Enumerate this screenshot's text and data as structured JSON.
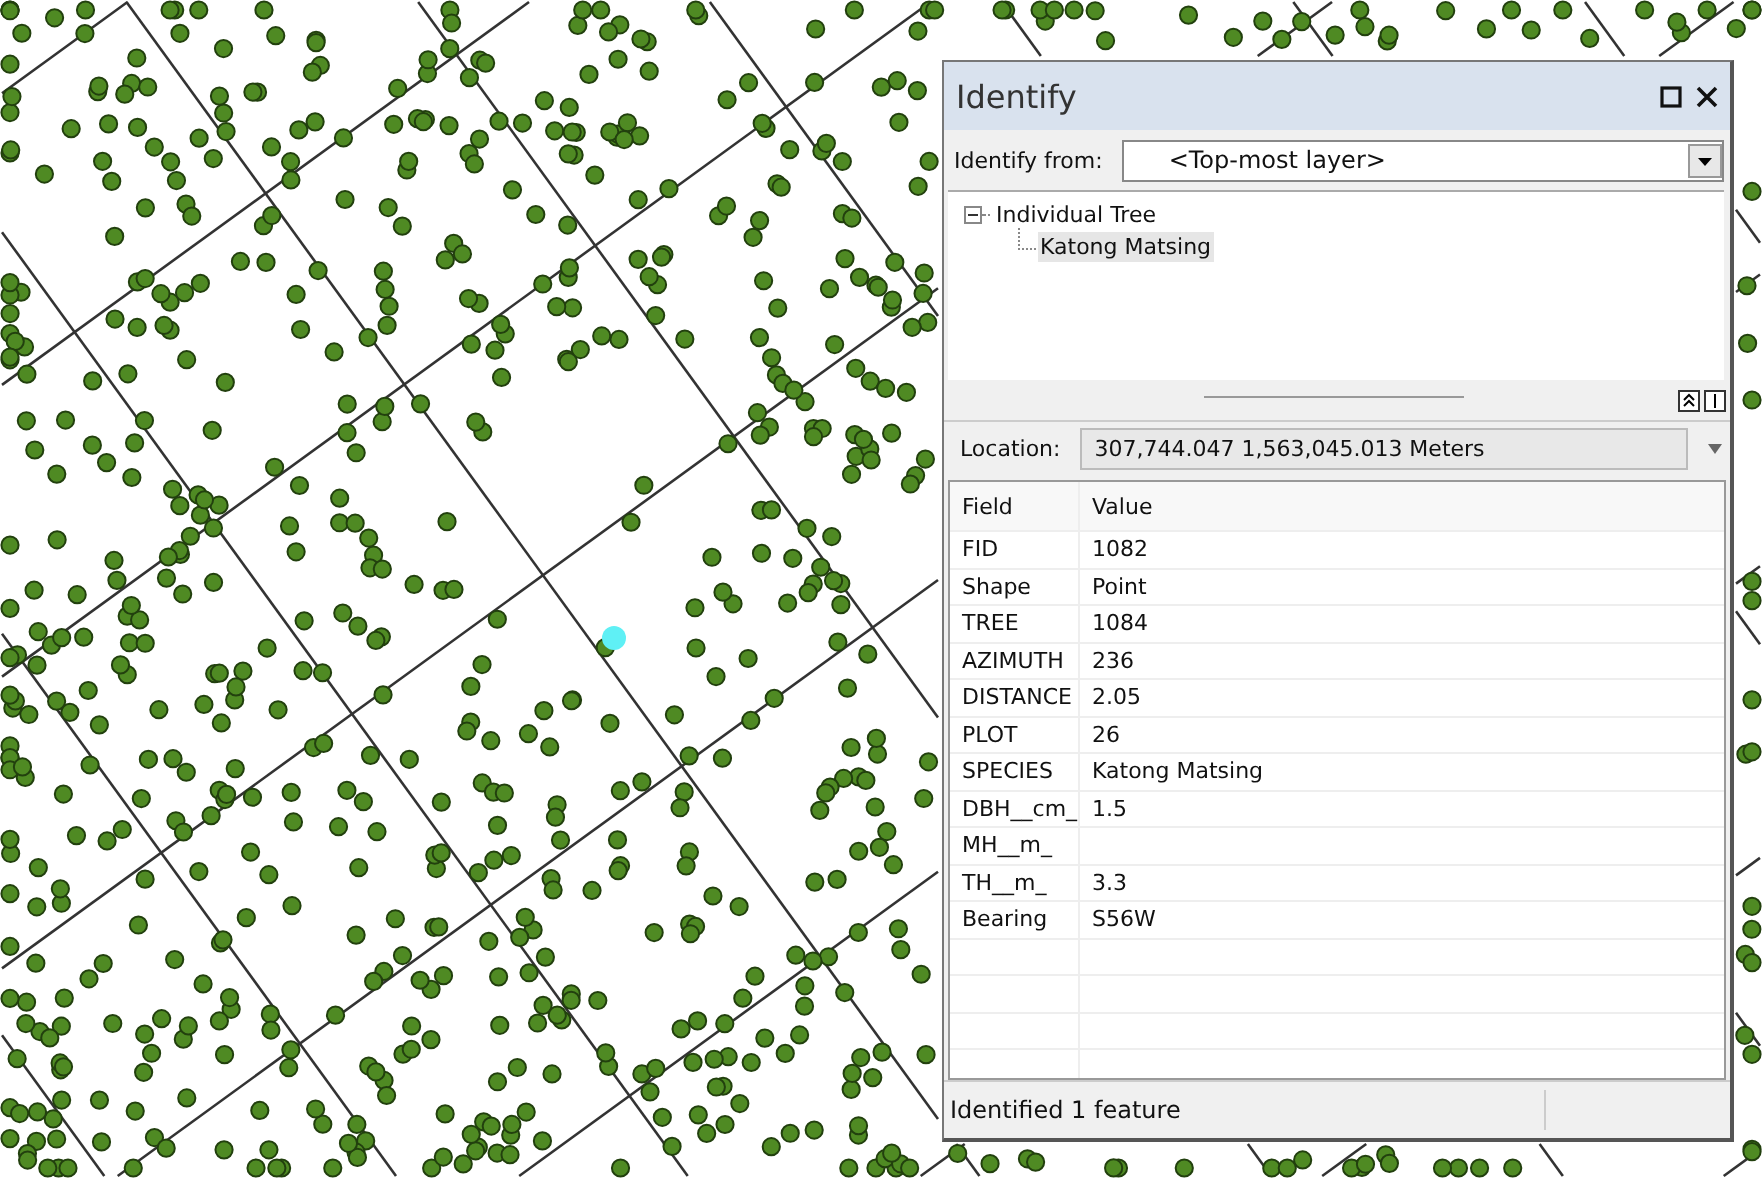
{
  "window": {
    "title": "Identify"
  },
  "identify_from": {
    "label": "Identify from:",
    "value": "<Top-most layer>"
  },
  "tree": [
    {
      "label": "Individual Tree",
      "expanded": true,
      "children": [
        {
          "label": "Katong Matsing",
          "selected": true
        }
      ]
    }
  ],
  "location": {
    "label": "Location:",
    "value": "307,744.047  1,563,045.013 Meters"
  },
  "table": {
    "columns": [
      "Field",
      "Value"
    ],
    "rows": [
      {
        "field": "FID",
        "value": "1082"
      },
      {
        "field": "Shape",
        "value": "Point"
      },
      {
        "field": "TREE",
        "value": "1084"
      },
      {
        "field": "AZIMUTH",
        "value": "236"
      },
      {
        "field": "DISTANCE",
        "value": "2.05"
      },
      {
        "field": "PLOT",
        "value": "26"
      },
      {
        "field": "SPECIES",
        "value": "Katong Matsing"
      },
      {
        "field": "DBH__cm_",
        "value": "1.5"
      },
      {
        "field": "MH__m_",
        "value": ""
      },
      {
        "field": "TH__m_",
        "value": "3.3"
      },
      {
        "field": "Bearing",
        "value": "S56W"
      }
    ]
  },
  "status_bar": "Identified 1 feature"
}
